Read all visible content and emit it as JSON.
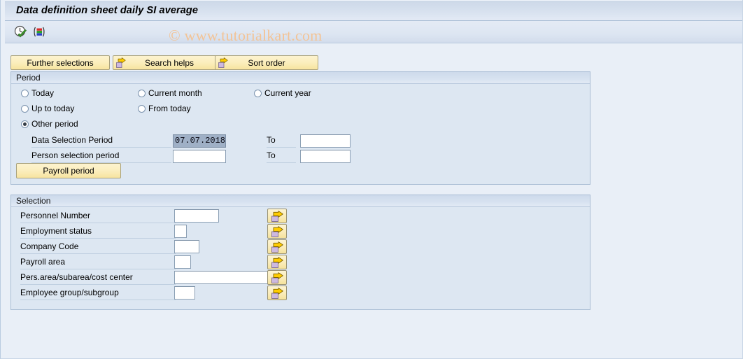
{
  "window": {
    "title": "Data definition sheet daily SI average",
    "watermark": "© www.tutorialkart.com"
  },
  "toolbar": {
    "icons": [
      {
        "name": "execute-clock-check-icon",
        "title": "Execute"
      },
      {
        "name": "variant-bars-icon",
        "title": "Get Variant"
      }
    ]
  },
  "action_buttons": [
    {
      "name": "further-selections-button",
      "label": "Further selections",
      "icon": "none"
    },
    {
      "name": "search-helps-button",
      "label": "Search helps",
      "icon": "yellow-arrow-icon"
    },
    {
      "name": "sort-order-button",
      "label": "Sort order",
      "icon": "yellow-arrow-icon"
    }
  ],
  "period": {
    "group_title": "Period",
    "radios": [
      {
        "name": "today",
        "label": "Today",
        "checked": false
      },
      {
        "name": "current-month",
        "label": "Current month",
        "checked": false
      },
      {
        "name": "current-year",
        "label": "Current year",
        "checked": false
      },
      {
        "name": "up-to-today",
        "label": "Up to today",
        "checked": false
      },
      {
        "name": "from-today",
        "label": "From today",
        "checked": false
      },
      {
        "name": "other-period",
        "label": "Other period",
        "checked": true
      }
    ],
    "fields": [
      {
        "name": "data-selection-period",
        "label": "Data Selection Period",
        "value": "07.07.2018",
        "selected": true,
        "to_label": "To",
        "to_value": ""
      },
      {
        "name": "person-selection-period",
        "label": "Person selection period",
        "value": "",
        "selected": false,
        "to_label": "To",
        "to_value": ""
      }
    ],
    "payroll_button_label": "Payroll period"
  },
  "selection": {
    "group_title": "Selection",
    "rows": [
      {
        "name": "personnel-number",
        "label": "Personnel Number",
        "value": "",
        "multi_select_icon": "yellow-arrow-icon"
      },
      {
        "name": "employment-status",
        "label": "Employment status",
        "value": "",
        "multi_select_icon": "yellow-arrow-icon"
      },
      {
        "name": "company-code",
        "label": "Company Code",
        "value": "",
        "multi_select_icon": "yellow-arrow-icon"
      },
      {
        "name": "payroll-area",
        "label": "Payroll area",
        "value": "",
        "multi_select_icon": "yellow-arrow-icon"
      },
      {
        "name": "pers-area-subarea-cost-center",
        "label": "Pers.area/subarea/cost center",
        "value": "",
        "multi_select_icon": "yellow-arrow-icon"
      },
      {
        "name": "employee-group-subgroup",
        "label": "Employee group/subgroup",
        "value": "",
        "multi_select_icon": "yellow-arrow-icon"
      }
    ]
  },
  "colors": {
    "page_background": "#e8eef7",
    "group_background": "#dde7f2",
    "button_yellow": "#fbeebd",
    "selected_field": "#9fb0c6",
    "watermark": "#f3c395",
    "arrow_yellow": "#ffcc00"
  }
}
